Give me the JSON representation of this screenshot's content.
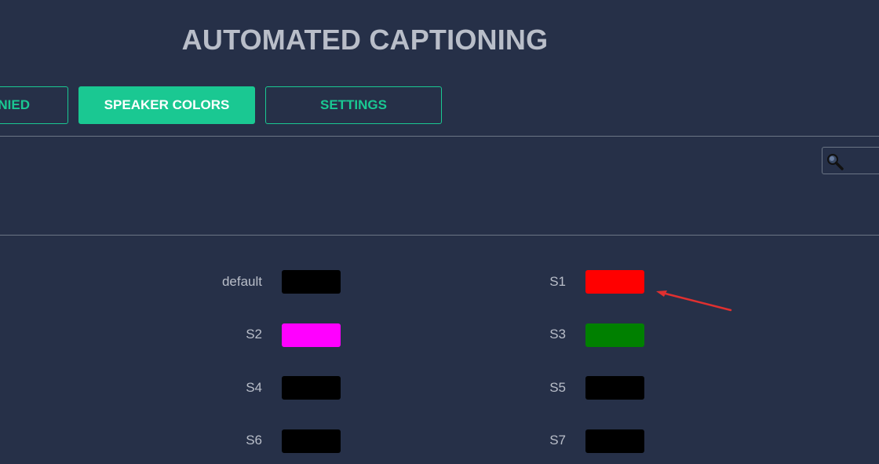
{
  "header": {
    "title": "AUTOMATED CAPTIONING"
  },
  "tabs": [
    {
      "label": "NIED",
      "active": false
    },
    {
      "label": "SPEAKER COLORS",
      "active": true
    },
    {
      "label": "SETTINGS",
      "active": false
    }
  ],
  "search": {
    "icon": "magnifier-icon",
    "value": ""
  },
  "speaker_colors": [
    {
      "label": "default",
      "color": "#000000"
    },
    {
      "label": "S1",
      "color": "#ff0000"
    },
    {
      "label": "S2",
      "color": "#ff00ff"
    },
    {
      "label": "S3",
      "color": "#008000"
    },
    {
      "label": "S4",
      "color": "#000000"
    },
    {
      "label": "S5",
      "color": "#000000"
    },
    {
      "label": "S6",
      "color": "#000000"
    },
    {
      "label": "S7",
      "color": "#000000"
    }
  ],
  "annotation": {
    "color": "#e03030",
    "points_to": "S1"
  },
  "colors": {
    "background": "#263048",
    "accent": "#1ac892",
    "text": "#b9bec9",
    "divider": "#6b7585"
  }
}
